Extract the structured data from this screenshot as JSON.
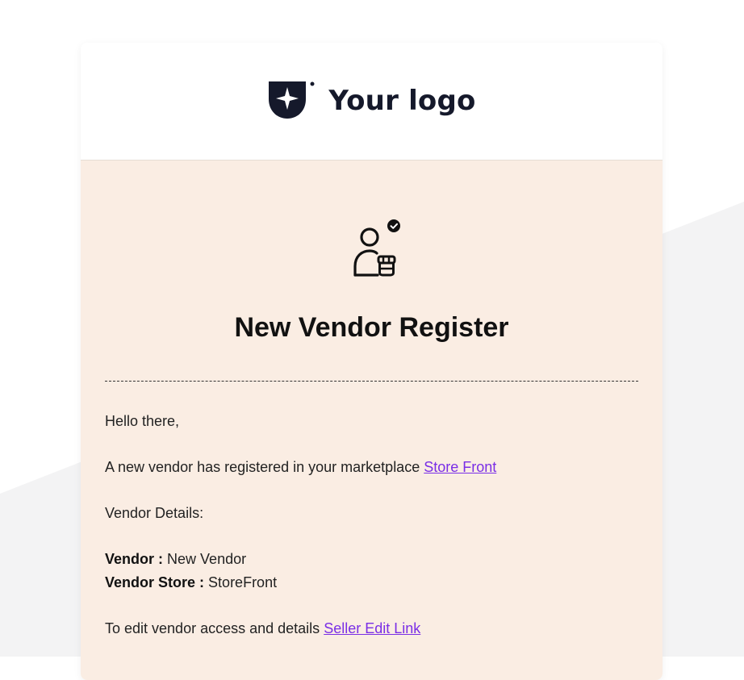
{
  "logo": {
    "text": "Your logo",
    "icon": "shield-star-icon",
    "color": "#15192b"
  },
  "hero": {
    "icon": "vendor-store-verified-icon",
    "title": "New Vendor Register"
  },
  "body": {
    "greeting": "Hello there,",
    "registered_text": "A new vendor has registered in your marketplace",
    "store_link": "Store Front",
    "details_heading": "Vendor Details:",
    "vendor_label": "Vendor :",
    "vendor_value": "New Vendor",
    "store_label": "Vendor Store :",
    "store_value": "StoreFront",
    "edit_text": "To edit vendor access and details",
    "edit_link": "Seller Edit Link"
  },
  "colors": {
    "page_background": "#ffffff",
    "background_shape": "#f3f3f4",
    "card_header": "#ffffff",
    "card_body": "#faede3",
    "link": "#7a2ee6",
    "text": "#222222"
  }
}
